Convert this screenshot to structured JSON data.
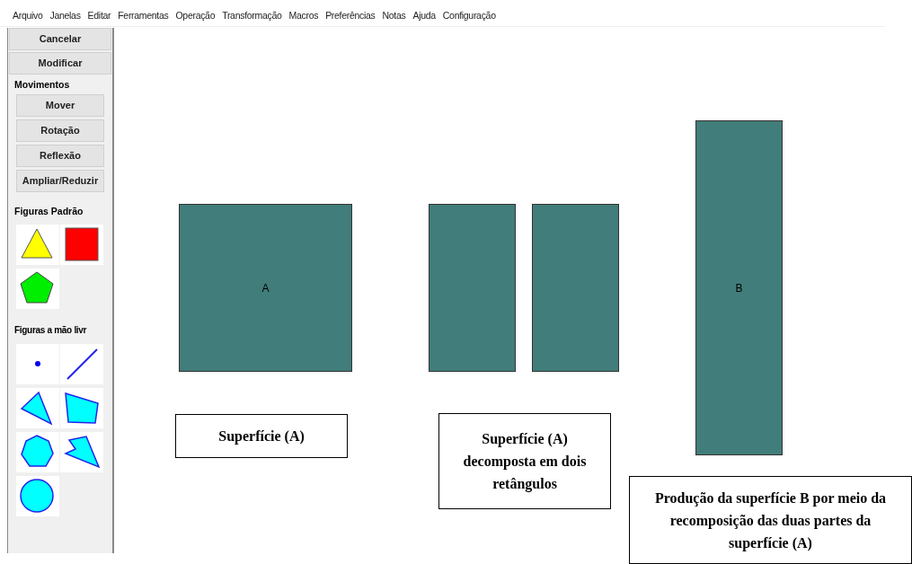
{
  "menu": [
    "Arquivo",
    "Janelas",
    "Editar",
    "Ferramentas",
    "Operação",
    "Transformação",
    "Macros",
    "Preferências",
    "Notas",
    "Ajuda",
    "Configuração"
  ],
  "sidebar": {
    "top_buttons": [
      "Cancelar",
      "Modificar"
    ],
    "movements": {
      "title": "Movimentos",
      "buttons": [
        "Mover",
        "Rotação",
        "Reflexão",
        "Ampliar/Reduzir"
      ]
    },
    "standard_figures": {
      "title": "Figuras Padrão",
      "items": [
        {
          "kind": "triangle"
        },
        {
          "kind": "square"
        },
        {
          "kind": "pentagon"
        }
      ]
    },
    "freehand_figures": {
      "title": "Figuras a mão livr",
      "items": [
        {
          "kind": "point"
        },
        {
          "kind": "segment"
        },
        {
          "kind": "triangle"
        },
        {
          "kind": "quadrilateral"
        },
        {
          "kind": "heptagon"
        },
        {
          "kind": "concave"
        },
        {
          "kind": "circle"
        }
      ]
    }
  },
  "canvas": {
    "shapes": [
      {
        "kind": "rectangle",
        "label": "A"
      },
      {
        "kind": "rectangle"
      },
      {
        "kind": "rectangle"
      },
      {
        "kind": "rectangle",
        "label": "B"
      }
    ],
    "captions": [
      "Superfície (A)",
      "Superfície (A) decomposta em dois retângulos",
      "Produção da superfície B por meio da recomposição das duas partes da superfície (A)"
    ]
  }
}
